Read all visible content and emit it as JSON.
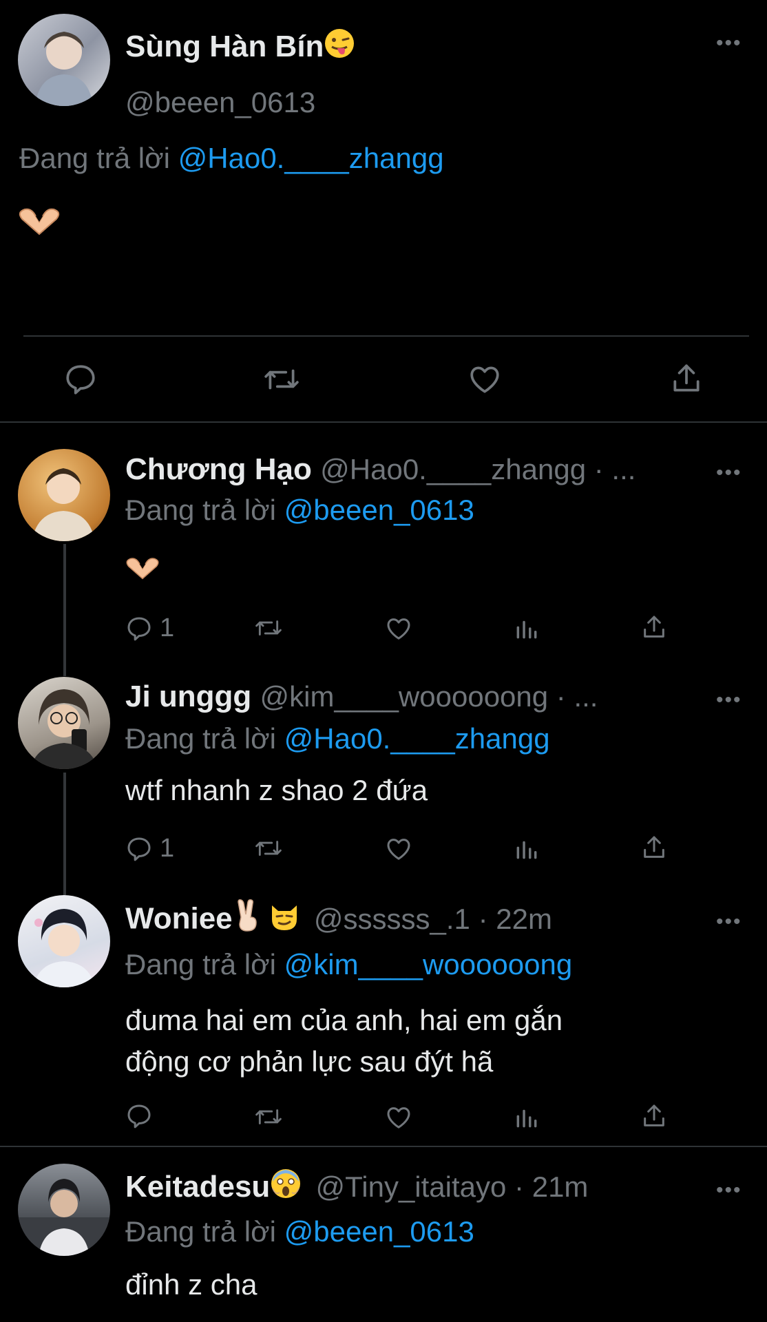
{
  "main_tweet": {
    "display_name": "Sùng Hàn Bín",
    "handle": "@beeen_0613",
    "replying_prefix": "Đang trả lời",
    "replying_to": "@Hao0.____zhangg",
    "body_emoji": "heart-hands",
    "name_emoji": "tongue-face"
  },
  "replies": [
    {
      "display_name": "Chương Hạo",
      "handle_time": "@Hao0.____zhangg · ...",
      "replying_prefix": "Đang trả lời",
      "replying_to": "@beeen_0613",
      "body_emoji": "heart-hands",
      "reply_count": "1"
    },
    {
      "display_name": "Ji unggg",
      "handle_time": "@kim____woooooong · ...",
      "replying_prefix": "Đang trả lời",
      "replying_to": "@Hao0.____zhangg",
      "text": "wtf nhanh z shao 2 đứa",
      "reply_count": "1"
    },
    {
      "display_name": "Woniee",
      "handle_time": "@ssssss_.1 · 22m",
      "replying_prefix": "Đang trả lời",
      "replying_to": "@kim____woooooong",
      "text_line1": "đuma hai em của anh, hai em gắn",
      "text_line2": "động cơ phản lực sau đýt hã",
      "name_emojis": [
        "victory-hand",
        "smirking-cat"
      ]
    },
    {
      "display_name": "Keitadesu",
      "handle_time": "@Tiny_itaitayo · 21m",
      "replying_prefix": "Đang trả lời",
      "replying_to": "@beeen_0613",
      "text": "đỉnh z cha",
      "name_emoji": "screaming-face"
    }
  ],
  "colors": {
    "background": "#000000",
    "text": "#e7e9ea",
    "muted": "#71767b",
    "link": "#1d9bf0",
    "divider": "#2f3336"
  }
}
